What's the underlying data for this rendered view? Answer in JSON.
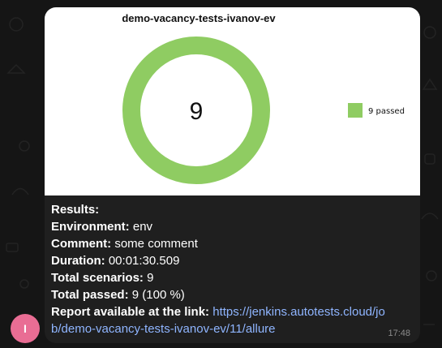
{
  "avatar": {
    "letter": "I",
    "color": "#e96d94"
  },
  "chart_data": {
    "type": "pie",
    "variant": "donut",
    "title": "demo-vacancy-tests-ivanov-ev",
    "center_label": "9",
    "slices": [
      {
        "label": "9 passed",
        "value": 9,
        "color": "#8fcc62"
      }
    ],
    "legend": [
      {
        "label": "9 passed",
        "color": "#8fcc62"
      }
    ],
    "legend_position": "right"
  },
  "results": {
    "heading": "Results:",
    "environment_label": "Environment:",
    "environment_value": "env",
    "comment_label": "Comment:",
    "comment_value": "some comment",
    "duration_label": "Duration:",
    "duration_value": "00:01:30.509",
    "scenarios_label": "Total scenarios:",
    "scenarios_value": "9",
    "passed_label": "Total passed:",
    "passed_value": "9 (100 %)",
    "report_label": "Report available at the link:",
    "report_link": "https://jenkins.autotests.cloud/job/demo-vacancy-tests-ivanov-ev/11/allure"
  },
  "message": {
    "time": "17:48"
  }
}
